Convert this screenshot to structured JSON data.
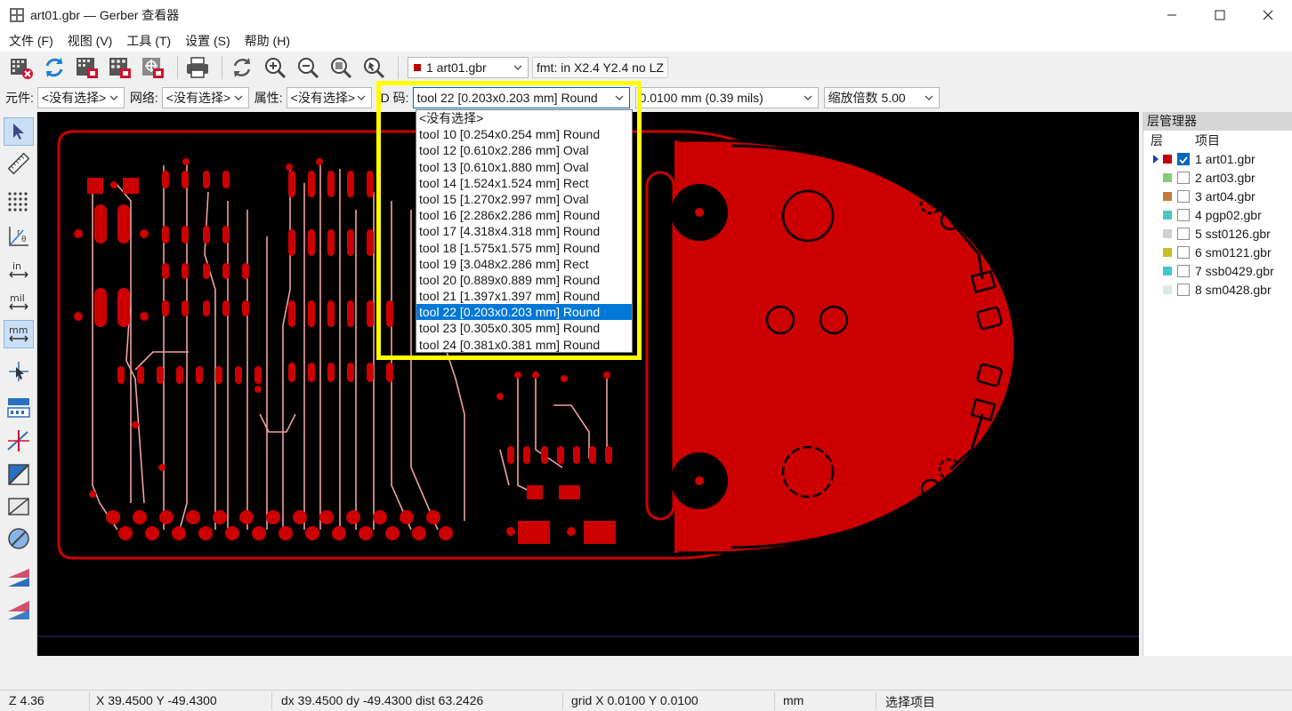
{
  "window": {
    "title": "art01.gbr — Gerber 查看器",
    "icons": [
      "app-icon",
      "minimize-icon",
      "maximize-icon",
      "close-icon"
    ]
  },
  "menu": [
    "文件 (F)",
    "视图 (V)",
    "工具 (T)",
    "设置 (S)",
    "帮助 (H)"
  ],
  "toolbar": {
    "icons": [
      "clear-layers-icon",
      "reload-icon",
      "open-gerber-icon",
      "open-drill-icon",
      "open-zip-icon",
      "print-icon",
      "redraw-icon",
      "zoom-in-icon",
      "zoom-out-icon",
      "zoom-fit-icon",
      "zoom-selection-icon"
    ],
    "active_layer": "1 art01.gbr",
    "format": "fmt: in X2.4 Y2.4 no LZ"
  },
  "filters": {
    "component_label": "元件:",
    "component_value": "<没有选择>",
    "net_label": "网络:",
    "net_value": "<没有选择>",
    "attribute_label": "属性:",
    "attribute_value": "<没有选择>",
    "dcode_label": "D 码:",
    "dcode_value": "tool 22 [0.203x0.203 mm] Round",
    "grid_value": "0.0100 mm (0.39 mils)",
    "zoom_value": "缩放倍数 5.00"
  },
  "dcode_dropdown": {
    "options": [
      "<没有选择>",
      "tool 10 [0.254x0.254 mm] Round",
      "tool 12 [0.610x2.286 mm] Oval",
      "tool 13 [0.610x1.880 mm] Oval",
      "tool 14 [1.524x1.524 mm] Rect",
      "tool 15 [1.270x2.997 mm] Oval",
      "tool 16 [2.286x2.286 mm] Round",
      "tool 17 [4.318x4.318 mm] Round",
      "tool 18 [1.575x1.575 mm] Round",
      "tool 19 [3.048x2.286 mm] Rect",
      "tool 20 [0.889x0.889 mm] Round",
      "tool 21 [1.397x1.397 mm] Round",
      "tool 22 [0.203x0.203 mm] Round",
      "tool 23 [0.305x0.305 mm] Round",
      "tool 24 [0.381x0.381 mm] Round"
    ],
    "selected_index": 12,
    "highlight_color": "#ffff00"
  },
  "left_tools": [
    "select-arrow-icon",
    "measure-ruler-icon",
    "grid-dots-icon",
    "polar-coords-icon",
    "inch-units-icon",
    "mil-units-icon",
    "mm-units-icon",
    "cursor-crosshair-icon",
    "dcode-display-icon",
    "flashed-items-sketch-icon",
    "lines-sketch-icon",
    "polygons-sketch-icon",
    "negative-objects-icon",
    "diff-mode-icon",
    "layers-transparent-icon",
    "layers-stacked-icon"
  ],
  "layer_manager": {
    "title": "层管理器",
    "col_layer": "层",
    "col_item": "项目",
    "layers": [
      {
        "name": "1 art01.gbr",
        "color": "#c00000",
        "checked": true
      },
      {
        "name": "2 art03.gbr",
        "color": "#86c97a",
        "checked": false
      },
      {
        "name": "3 art04.gbr",
        "color": "#c47a3a",
        "checked": false
      },
      {
        "name": "4 pgp02.gbr",
        "color": "#4ec6c6",
        "checked": false
      },
      {
        "name": "5 sst0126.gbr",
        "color": "#d0d0d0",
        "checked": false
      },
      {
        "name": "6 sm0121.gbr",
        "color": "#c8c020",
        "checked": false
      },
      {
        "name": "7 ssb0429.gbr",
        "color": "#40c8d0",
        "checked": false
      },
      {
        "name": "8 sm0428.gbr",
        "color": "#dde8e0",
        "checked": false
      }
    ]
  },
  "pcb_colors": {
    "copper": "#cc0000",
    "trace": "#f0a0a0",
    "background": "#000000"
  },
  "status": {
    "zoom": "Z 4.36",
    "xy": "X 39.4500  Y -49.4300",
    "dxdy": "dx 39.4500  dy -49.4300  dist 63.2426",
    "grid": "grid X 0.0100  Y 0.0100",
    "units": "mm",
    "hint": "选择项目"
  }
}
